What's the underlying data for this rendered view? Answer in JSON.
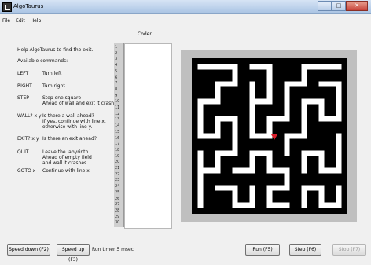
{
  "window": {
    "title": "AlgoTaurus",
    "controls": [
      "‒",
      "□",
      "✕"
    ]
  },
  "menu": [
    "File",
    "Edit",
    "Help"
  ],
  "coder_label": "Coder",
  "help": {
    "intro": "Help AlgoTaurus to find the exit.",
    "available": "Available commands:",
    "commands": [
      {
        "cmd": "LEFT",
        "desc": [
          "Turn left"
        ]
      },
      {
        "cmd": "RIGHT",
        "desc": [
          "Turn right"
        ]
      },
      {
        "cmd": "STEP",
        "desc": [
          "Step one square",
          "Ahead of wall and exit it crashes."
        ]
      },
      {
        "cmd": "WALL? x y",
        "desc": [
          "Is there a wall ahead?",
          "If yes, continue with line x,",
          "otherwise with line y."
        ]
      },
      {
        "cmd": "EXIT? x y",
        "desc": [
          "Is there an exit ahead?"
        ]
      },
      {
        "cmd": "QUIT",
        "desc": [
          "Leave the labyrinth",
          "Ahead of empty field",
          "and wall it crashes."
        ]
      },
      {
        "cmd": "GOTO x",
        "desc": [
          "Continue with line x"
        ]
      }
    ]
  },
  "line_numbers": [
    "1",
    "2",
    "3",
    "4",
    "5",
    "6",
    "7",
    "8",
    "9",
    "10",
    "11",
    "12",
    "13",
    "14",
    "15",
    "16",
    "17",
    "18",
    "19",
    "20",
    "21",
    "22",
    "23",
    "24",
    "25",
    "26",
    "27",
    "28",
    "29",
    "30"
  ],
  "editor_text": "",
  "toolbar": {
    "speed_down": "Speed down (F2)",
    "speed_up": "Speed up (F3)",
    "timer": "Run timer 5 msec",
    "run": "Run (F5)",
    "step": "Step (F6)",
    "stop": "Stop (F7)"
  },
  "colors": {
    "robot": "#d81e2a",
    "maze_wall": "#000000",
    "maze_path": "#ffffff",
    "frame": "#bfbfbf"
  }
}
